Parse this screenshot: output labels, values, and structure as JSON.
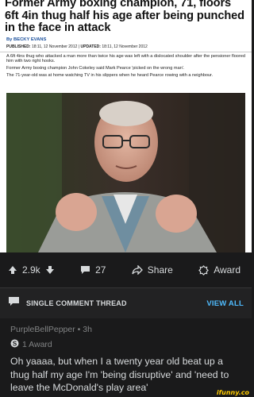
{
  "article": {
    "headline": "Former Army boxing champion, 71, floors 6ft 4in thug half his age after being punched in the face in attack",
    "byline": "By BECKY EVANS",
    "published_label": "PUBLISHED:",
    "published_value": "18:11, 12 November 2012",
    "updated_label": "UPDATED:",
    "updated_value": "18:11, 12 November 2012",
    "paragraphs": [
      "A 6ft 4ins thug who attacked a man more than twice his age was left with a dislocated shoulder after the pensioner floored him with two right hooks.",
      "Former Army boxing champion John Cokeley said Mark Pearce 'picked on the wrong man'.",
      "The 71-year-old was at home watching TV in his slippers when he heard Pearce rowing with a neighbour."
    ]
  },
  "actions": {
    "votes": "2.9k",
    "comments": "27",
    "share_label": "Share",
    "award_label": "Award"
  },
  "thread": {
    "label": "SINGLE COMMENT THREAD",
    "view_all": "VIEW ALL"
  },
  "comment": {
    "author": "PurpleBellPepper",
    "separator": "•",
    "age": "3h",
    "award_text": "1 Award",
    "body": "Oh yaaaa, but when I a twenty year old beat up a thug half my age I'm 'being disruptive' and 'need to leave the McDonald's play area'"
  },
  "watermark": "ifunny.co",
  "colors": {
    "background": "#1a1a1b",
    "text": "#d7dadc",
    "muted": "#818384",
    "link": "#4fbcff",
    "byline": "#1a4f9c"
  }
}
